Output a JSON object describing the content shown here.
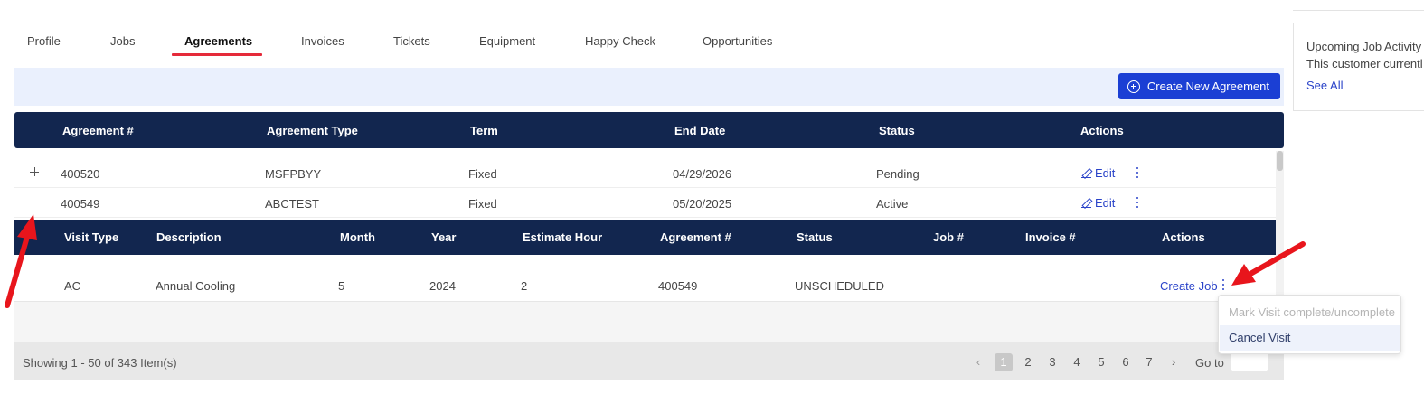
{
  "tabs": [
    {
      "label": "Profile",
      "active": false
    },
    {
      "label": "Jobs",
      "active": false
    },
    {
      "label": "Agreements",
      "active": true
    },
    {
      "label": "Invoices",
      "active": false
    },
    {
      "label": "Tickets",
      "active": false
    },
    {
      "label": "Equipment",
      "active": false
    },
    {
      "label": "Happy Check",
      "active": false
    },
    {
      "label": "Opportunities",
      "active": false
    }
  ],
  "toolbar": {
    "create_label": "Create New Agreement",
    "create_icon": "plus-circle-icon"
  },
  "table": {
    "columns": [
      "Agreement #",
      "Agreement Type",
      "Term",
      "End Date",
      "Status",
      "Actions"
    ],
    "rows": [
      {
        "number": "400520",
        "type": "MSFPBYY",
        "term": "Fixed",
        "end_date": "04/29/2026",
        "status": "Pending",
        "edit_label": "Edit",
        "expanded": false
      },
      {
        "number": "400549",
        "type": "ABCTEST",
        "term": "Fixed",
        "end_date": "05/20/2025",
        "status": "Active",
        "edit_label": "Edit",
        "expanded": true
      }
    ]
  },
  "visits": {
    "columns": [
      "Visit Type",
      "Description",
      "Month",
      "Year",
      "Estimate Hour",
      "Agreement #",
      "Status",
      "Job #",
      "Invoice #",
      "Actions"
    ],
    "rows": [
      {
        "visit_type": "AC",
        "description": "Annual Cooling",
        "month": "5",
        "year": "2024",
        "estimate_hour": "2",
        "agreement": "400549",
        "status": "UNSCHEDULED",
        "job": "",
        "invoice": "",
        "action_label": "Create Job"
      }
    ]
  },
  "context_menu": {
    "items": [
      {
        "label": "Mark Visit complete/uncomplete",
        "disabled": true
      },
      {
        "label": "Cancel Visit",
        "disabled": false
      }
    ]
  },
  "pagination": {
    "summary": "Showing 1 - 50 of 343 Item(s)",
    "pages": [
      "1",
      "2",
      "3",
      "4",
      "5",
      "6",
      "7"
    ],
    "current": "1",
    "goto_label": "Go to",
    "goto_value": ""
  },
  "side_panel": {
    "title": "Upcoming Job Activity",
    "text": "This customer currentl",
    "link": "See All"
  },
  "colors": {
    "header_bg": "#12264f",
    "accent": "#1b3fd4",
    "tab_underline": "#e52a3a",
    "link": "#2a43c9",
    "annotation_arrow": "#e8151c"
  }
}
